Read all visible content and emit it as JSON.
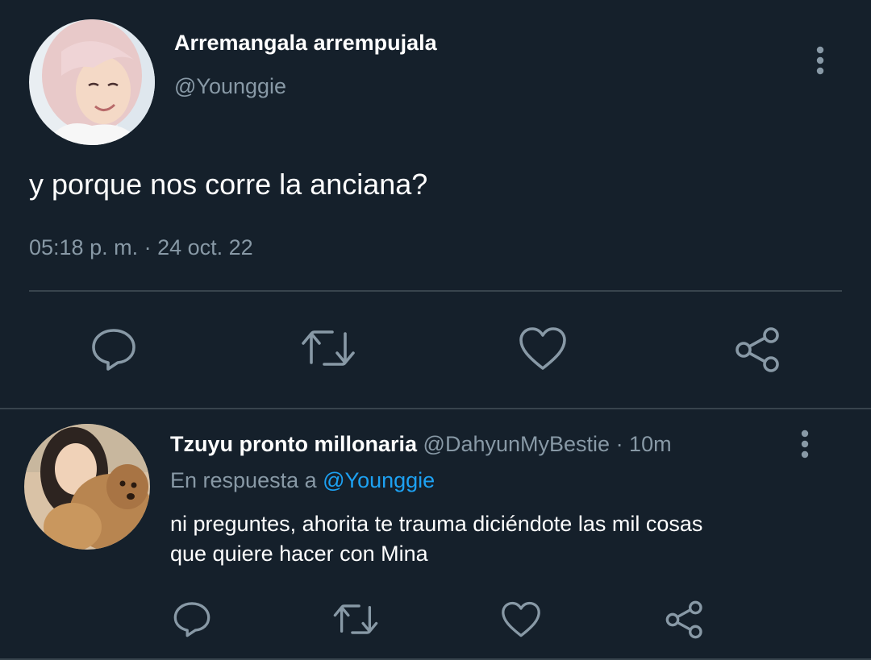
{
  "main_tweet": {
    "display_name": "Arremangala arrempujala",
    "handle": "@Younggie",
    "text": "y porque nos corre la anciana?",
    "timestamp": "05:18 p. m. · 24 oct. 22",
    "avatar_icon": "user-avatar-pink-hair",
    "more_icon": "more-vertical-icon",
    "actions": [
      "reply-icon",
      "retweet-icon",
      "like-icon",
      "share-icon"
    ]
  },
  "reply": {
    "display_name": "Tzuyu pronto millonaria",
    "handle": "@DahyunMyBestie",
    "time": "· 10m",
    "replying_prefix": "En respuesta a",
    "replying_to": "@Younggie",
    "text_line1": "ni preguntes, ahorita te trauma diciéndote las mil cosas",
    "text_line2": "que quiere hacer con Mina",
    "avatar_icon": "user-avatar-with-dog",
    "more_icon": "more-vertical-icon",
    "actions": [
      "reply-icon",
      "retweet-icon",
      "like-icon",
      "share-icon"
    ]
  },
  "colors": {
    "background": "#15202b",
    "text": "#ffffff",
    "muted": "#8899a6",
    "link": "#1da1f2",
    "divider": "#38444d"
  }
}
